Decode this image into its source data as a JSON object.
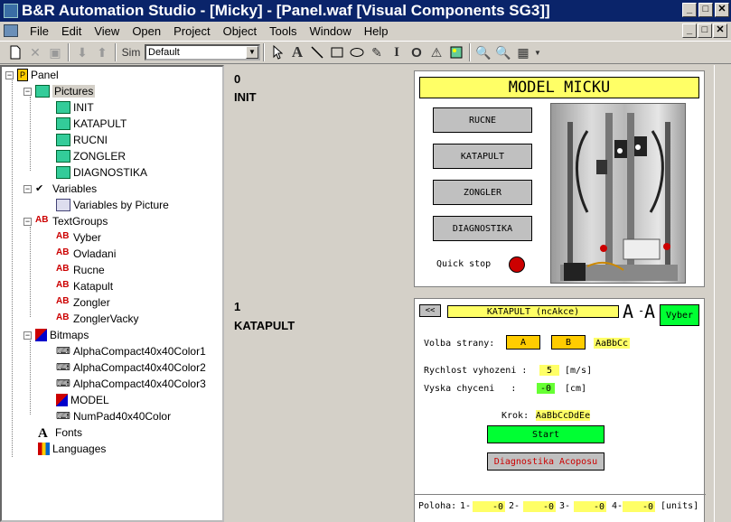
{
  "window": {
    "title": "B&R Automation Studio - [Micky] - [Panel.waf [Visual Components SG3]]",
    "buttons": {
      "minimize": "_",
      "maximize": "□",
      "close": "✕"
    }
  },
  "menu": [
    "File",
    "Edit",
    "View",
    "Open",
    "Project",
    "Object",
    "Tools",
    "Window",
    "Help"
  ],
  "toolbar": {
    "sim_label": "Sim",
    "combo_value": "Default"
  },
  "tree": {
    "root": "Panel",
    "pictures": {
      "label": "Pictures",
      "items": [
        "INIT",
        "KATAPULT",
        "RUCNI",
        "ZONGLER",
        "DIAGNOSTIKA"
      ]
    },
    "variables": {
      "label": "Variables",
      "items": [
        "Variables by Picture"
      ]
    },
    "textgroups": {
      "label": "TextGroups",
      "items": [
        "Vyber",
        "Ovladani",
        "Rucne",
        "Katapult",
        "Zongler",
        "ZonglerVacky"
      ]
    },
    "bitmaps": {
      "label": "Bitmaps",
      "items": [
        "AlphaCompact40x40Color1",
        "AlphaCompact40x40Color2",
        "AlphaCompact40x40Color3",
        "MODEL",
        "NumPad40x40Color"
      ]
    },
    "fonts": "Fonts",
    "languages": "Languages"
  },
  "pictures": [
    {
      "index": "0",
      "name": "INIT",
      "banner": "MODEL MICKU",
      "buttons": [
        "RUCNE",
        "KATAPULT",
        "ZONGLER",
        "DIAGNOSTIKA"
      ],
      "quick_stop": "Quick stop"
    },
    {
      "index": "1",
      "name": "KATAPULT",
      "back": "<<",
      "header": "KATAPULT (ncAkce)",
      "font_a": "A",
      "font_dash": "-",
      "font_b": "A",
      "vyber": "Vyber",
      "volba_label": "Volba strany:",
      "side_a": "A",
      "side_b": "B",
      "sample1": "AaBbCc",
      "rychlost_label": "Rychlost vyhozeni :",
      "rychlost_value": "5",
      "rychlost_unit": "[m/s]",
      "vyska_label": "Vyska chyceni   :",
      "vyska_value": "-0",
      "vyska_unit": "[cm]",
      "krok_label": "Krok:",
      "krok_value": "AaBbCcDdEe",
      "start": "Start",
      "diag": "Diagnostika Acoposu",
      "poloha_label": "Poloha:",
      "poloha": [
        {
          "n": "1-",
          "v": "-0"
        },
        {
          "n": "2-",
          "v": "-0"
        },
        {
          "n": "3-",
          "v": "-0"
        },
        {
          "n": "4-",
          "v": "-0"
        }
      ],
      "units": "[units]"
    }
  ],
  "colors": {
    "title": "#0a246a",
    "yellow": "#ffff66",
    "green": "#00ff33",
    "orange": "#ffcc00",
    "stop": "#cc0000"
  }
}
